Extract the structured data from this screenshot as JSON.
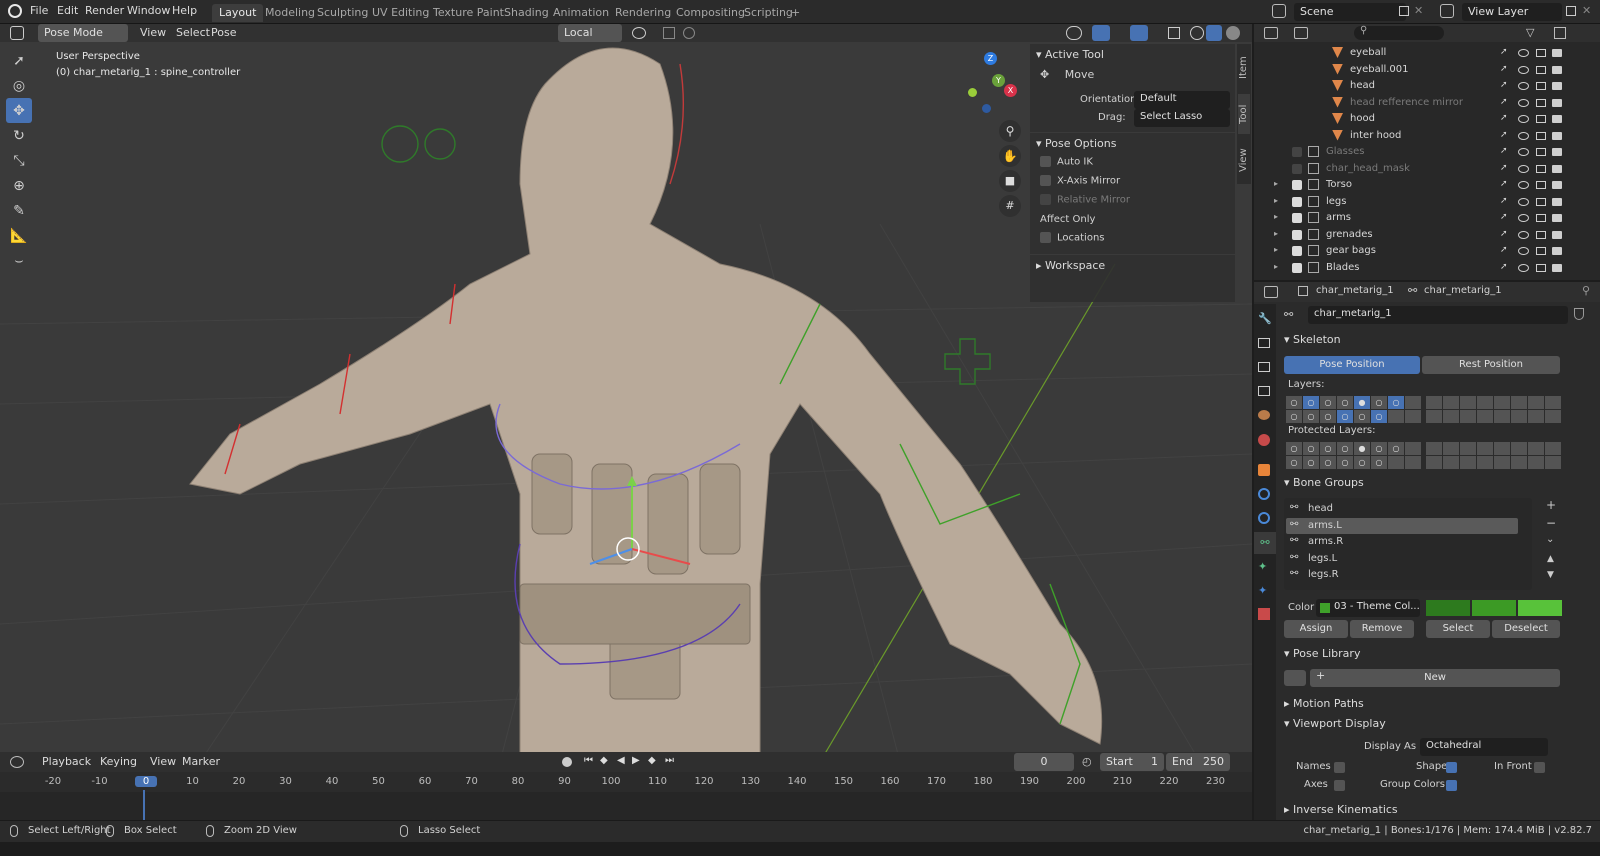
{
  "topbar": {
    "menus": [
      "File",
      "Edit",
      "Render",
      "Window",
      "Help"
    ],
    "workspaces": [
      "Layout",
      "Modeling",
      "Sculpting",
      "UV Editing",
      "Texture Paint",
      "Shading",
      "Animation",
      "Rendering",
      "Compositing",
      "Scripting"
    ],
    "active_workspace": "Layout",
    "add_tab": "+",
    "scene": "Scene",
    "view_layer": "View Layer"
  },
  "viewport": {
    "mode": "Pose Mode",
    "menus": [
      "View",
      "Select",
      "Pose"
    ],
    "transform_orientation": "Local",
    "overlay_title": "User Perspective",
    "overlay_subtitle": "(0) char_metarig_1 : spine_controller",
    "gizmo_axes": [
      "Z",
      "Y",
      "X"
    ]
  },
  "npanel": {
    "tabs": [
      "Item",
      "Tool",
      "View"
    ],
    "active_tool_header": "Active Tool",
    "tool_name": "Move",
    "orientation_label": "Orientation",
    "orientation_value": "Default",
    "drag_label": "Drag:",
    "drag_value": "Select Lasso",
    "pose_options_header": "Pose Options",
    "auto_ik": "Auto IK",
    "x_axis_mirror": "X-Axis Mirror",
    "relative_mirror": "Relative Mirror",
    "affect_only": "Affect Only",
    "locations": "Locations",
    "workspace": "Workspace"
  },
  "outliner": {
    "rows": [
      {
        "name": "eyeball",
        "dim": false
      },
      {
        "name": "eyeball.001",
        "dim": false
      },
      {
        "name": "head",
        "dim": false
      },
      {
        "name": "head refference mirror",
        "dim": true
      },
      {
        "name": "hood",
        "dim": false
      },
      {
        "name": "inter hood",
        "dim": false
      },
      {
        "name": "Glasses",
        "dim": true
      },
      {
        "name": "char_head_mask",
        "dim": true
      },
      {
        "name": "Torso",
        "dim": false
      },
      {
        "name": "legs",
        "dim": false
      },
      {
        "name": "arms",
        "dim": false
      },
      {
        "name": "grenades",
        "dim": false
      },
      {
        "name": "gear bags",
        "dim": false
      },
      {
        "name": "Blades",
        "dim": false
      }
    ]
  },
  "properties": {
    "breadcrumb_1": "char_metarig_1",
    "breadcrumb_2": "char_metarig_1",
    "data_name": "char_metarig_1",
    "skeleton_header": "Skeleton",
    "pose_position": "Pose Position",
    "rest_position": "Rest Position",
    "layers_label": "Layers:",
    "protected_layers_label": "Protected Layers:",
    "bone_groups_header": "Bone Groups",
    "bone_groups": [
      "head",
      "arms.L",
      "arms.R",
      "legs.L",
      "legs.R"
    ],
    "selected_group": "arms.L",
    "color_label": "Color",
    "color_value": "03 - Theme Col...",
    "assign": "Assign",
    "remove": "Remove",
    "select": "Select",
    "deselect": "Deselect",
    "pose_library_header": "Pose Library",
    "new_button": "New",
    "motion_paths_header": "Motion Paths",
    "viewport_display_header": "Viewport Display",
    "display_as_label": "Display As",
    "display_as_value": "Octahedral",
    "names_label": "Names",
    "shapes_label": "Shapes",
    "in_front_label": "In Front",
    "axes_label": "Axes",
    "group_colors_label": "Group Colors",
    "inverse_kinematics_header": "Inverse Kinematics"
  },
  "timeline": {
    "menus": [
      "Playback",
      "Keying",
      "View",
      "Marker"
    ],
    "current_frame": "0",
    "start_label": "Start",
    "start_value": "1",
    "end_label": "End",
    "end_value": "250",
    "ruler": [
      "-20",
      "-10",
      "0",
      "10",
      "20",
      "30",
      "40",
      "50",
      "60",
      "70",
      "80",
      "90",
      "100",
      "110",
      "120",
      "130",
      "140",
      "150",
      "160",
      "170",
      "180",
      "190",
      "200",
      "210",
      "220",
      "230"
    ]
  },
  "statusbar": {
    "select": "Select Left/Right",
    "box_select": "Box Select",
    "zoom": "Zoom 2D View",
    "lasso": "Lasso Select",
    "stats": "char_metarig_1 | Bones:1/176 | Mem: 174.4 MiB | v2.82.7"
  },
  "colors": {
    "accent": "#4772b3",
    "bone_group_green": "#3fa12a",
    "model": "#b9aa9a"
  }
}
